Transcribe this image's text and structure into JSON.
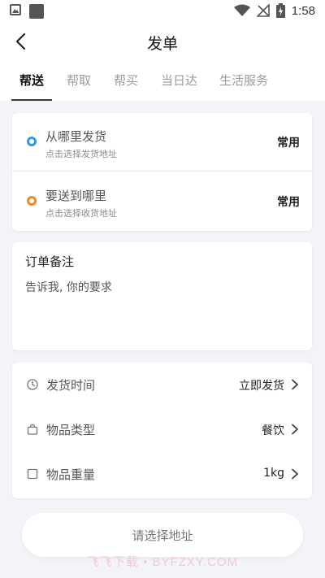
{
  "status_bar": {
    "time": "1:58"
  },
  "header": {
    "title": "发单"
  },
  "tabs": [
    {
      "label": "帮送",
      "active": true
    },
    {
      "label": "帮取",
      "active": false
    },
    {
      "label": "帮买",
      "active": false
    },
    {
      "label": "当日达",
      "active": false
    },
    {
      "label": "生活服务",
      "active": false
    }
  ],
  "addresses": [
    {
      "title": "从哪里发货",
      "subtitle": "点击选择发货地址",
      "action": "常用",
      "dot_color": "#2b9ae8"
    },
    {
      "title": "要送到哪里",
      "subtitle": "点击选择收货地址",
      "action": "常用",
      "dot_color": "#f08a2a"
    }
  ],
  "note": {
    "title": "订单备注",
    "placeholder": "告诉我, 你的要求"
  },
  "options": [
    {
      "label": "发货时间",
      "value": "立即发货",
      "icon": "clock-icon"
    },
    {
      "label": "物品类型",
      "value": "餐饮",
      "icon": "bag-icon"
    },
    {
      "label": "物品重量",
      "value": "1kg",
      "icon": "box-icon"
    }
  ],
  "submit": {
    "label": "请选择地址"
  },
  "watermark": "飞飞下载 • BYFZXY.COM",
  "colors": {
    "accent_blue": "#2b9ae8",
    "accent_orange": "#f08a2a",
    "background": "#f3f4f8"
  }
}
